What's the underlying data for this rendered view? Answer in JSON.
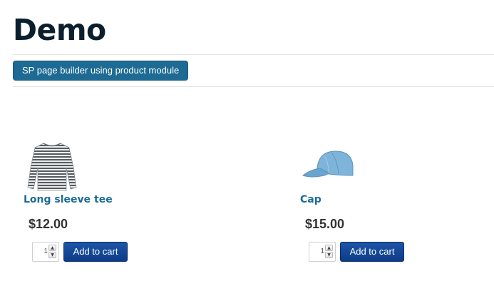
{
  "page": {
    "title": "Demo"
  },
  "badge": {
    "label": "SP page builder using product module"
  },
  "products": [
    {
      "name": "Long sleeve tee",
      "price": "$12.00",
      "quantity": "1",
      "add_to_cart": "Add to cart",
      "image_icon": "striped-long-sleeve-tee-image"
    },
    {
      "name": "Cap",
      "price": "$15.00",
      "quantity": "1",
      "add_to_cart": "Add to cart",
      "image_icon": "blue-cap-image"
    }
  ],
  "colors": {
    "title": "#0b1f2e",
    "badge_bg": "#1d6b94",
    "product_link": "#1d6b94",
    "cart_button": "#0c3c86"
  }
}
